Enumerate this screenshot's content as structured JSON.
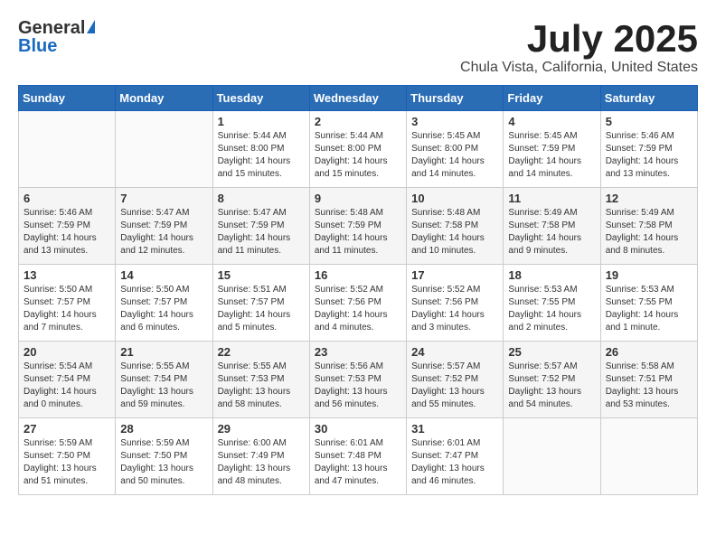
{
  "header": {
    "logo_general": "General",
    "logo_blue": "Blue",
    "month_title": "July 2025",
    "location": "Chula Vista, California, United States"
  },
  "weekdays": [
    "Sunday",
    "Monday",
    "Tuesday",
    "Wednesday",
    "Thursday",
    "Friday",
    "Saturday"
  ],
  "weeks": [
    [
      {
        "day": "",
        "info": ""
      },
      {
        "day": "",
        "info": ""
      },
      {
        "day": "1",
        "info": "Sunrise: 5:44 AM\nSunset: 8:00 PM\nDaylight: 14 hours and 15 minutes."
      },
      {
        "day": "2",
        "info": "Sunrise: 5:44 AM\nSunset: 8:00 PM\nDaylight: 14 hours and 15 minutes."
      },
      {
        "day": "3",
        "info": "Sunrise: 5:45 AM\nSunset: 8:00 PM\nDaylight: 14 hours and 14 minutes."
      },
      {
        "day": "4",
        "info": "Sunrise: 5:45 AM\nSunset: 7:59 PM\nDaylight: 14 hours and 14 minutes."
      },
      {
        "day": "5",
        "info": "Sunrise: 5:46 AM\nSunset: 7:59 PM\nDaylight: 14 hours and 13 minutes."
      }
    ],
    [
      {
        "day": "6",
        "info": "Sunrise: 5:46 AM\nSunset: 7:59 PM\nDaylight: 14 hours and 13 minutes."
      },
      {
        "day": "7",
        "info": "Sunrise: 5:47 AM\nSunset: 7:59 PM\nDaylight: 14 hours and 12 minutes."
      },
      {
        "day": "8",
        "info": "Sunrise: 5:47 AM\nSunset: 7:59 PM\nDaylight: 14 hours and 11 minutes."
      },
      {
        "day": "9",
        "info": "Sunrise: 5:48 AM\nSunset: 7:59 PM\nDaylight: 14 hours and 11 minutes."
      },
      {
        "day": "10",
        "info": "Sunrise: 5:48 AM\nSunset: 7:58 PM\nDaylight: 14 hours and 10 minutes."
      },
      {
        "day": "11",
        "info": "Sunrise: 5:49 AM\nSunset: 7:58 PM\nDaylight: 14 hours and 9 minutes."
      },
      {
        "day": "12",
        "info": "Sunrise: 5:49 AM\nSunset: 7:58 PM\nDaylight: 14 hours and 8 minutes."
      }
    ],
    [
      {
        "day": "13",
        "info": "Sunrise: 5:50 AM\nSunset: 7:57 PM\nDaylight: 14 hours and 7 minutes."
      },
      {
        "day": "14",
        "info": "Sunrise: 5:50 AM\nSunset: 7:57 PM\nDaylight: 14 hours and 6 minutes."
      },
      {
        "day": "15",
        "info": "Sunrise: 5:51 AM\nSunset: 7:57 PM\nDaylight: 14 hours and 5 minutes."
      },
      {
        "day": "16",
        "info": "Sunrise: 5:52 AM\nSunset: 7:56 PM\nDaylight: 14 hours and 4 minutes."
      },
      {
        "day": "17",
        "info": "Sunrise: 5:52 AM\nSunset: 7:56 PM\nDaylight: 14 hours and 3 minutes."
      },
      {
        "day": "18",
        "info": "Sunrise: 5:53 AM\nSunset: 7:55 PM\nDaylight: 14 hours and 2 minutes."
      },
      {
        "day": "19",
        "info": "Sunrise: 5:53 AM\nSunset: 7:55 PM\nDaylight: 14 hours and 1 minute."
      }
    ],
    [
      {
        "day": "20",
        "info": "Sunrise: 5:54 AM\nSunset: 7:54 PM\nDaylight: 14 hours and 0 minutes."
      },
      {
        "day": "21",
        "info": "Sunrise: 5:55 AM\nSunset: 7:54 PM\nDaylight: 13 hours and 59 minutes."
      },
      {
        "day": "22",
        "info": "Sunrise: 5:55 AM\nSunset: 7:53 PM\nDaylight: 13 hours and 58 minutes."
      },
      {
        "day": "23",
        "info": "Sunrise: 5:56 AM\nSunset: 7:53 PM\nDaylight: 13 hours and 56 minutes."
      },
      {
        "day": "24",
        "info": "Sunrise: 5:57 AM\nSunset: 7:52 PM\nDaylight: 13 hours and 55 minutes."
      },
      {
        "day": "25",
        "info": "Sunrise: 5:57 AM\nSunset: 7:52 PM\nDaylight: 13 hours and 54 minutes."
      },
      {
        "day": "26",
        "info": "Sunrise: 5:58 AM\nSunset: 7:51 PM\nDaylight: 13 hours and 53 minutes."
      }
    ],
    [
      {
        "day": "27",
        "info": "Sunrise: 5:59 AM\nSunset: 7:50 PM\nDaylight: 13 hours and 51 minutes."
      },
      {
        "day": "28",
        "info": "Sunrise: 5:59 AM\nSunset: 7:50 PM\nDaylight: 13 hours and 50 minutes."
      },
      {
        "day": "29",
        "info": "Sunrise: 6:00 AM\nSunset: 7:49 PM\nDaylight: 13 hours and 48 minutes."
      },
      {
        "day": "30",
        "info": "Sunrise: 6:01 AM\nSunset: 7:48 PM\nDaylight: 13 hours and 47 minutes."
      },
      {
        "day": "31",
        "info": "Sunrise: 6:01 AM\nSunset: 7:47 PM\nDaylight: 13 hours and 46 minutes."
      },
      {
        "day": "",
        "info": ""
      },
      {
        "day": "",
        "info": ""
      }
    ]
  ]
}
